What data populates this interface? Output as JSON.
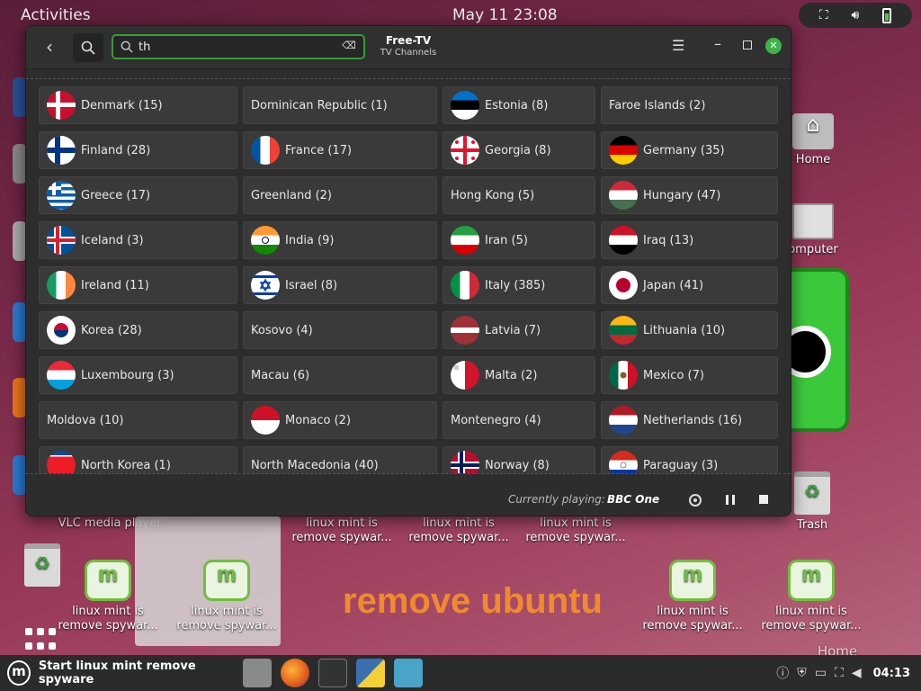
{
  "topbar": {
    "activities": "Activities",
    "clock": "May 11  23:08",
    "system_icons": [
      "network-icon",
      "volume-icon",
      "battery-icon"
    ]
  },
  "desktop": {
    "icons": [
      {
        "label": "Home",
        "type": "folder"
      },
      {
        "label": "omputer",
        "type": "computer"
      },
      {
        "label": "Trash",
        "type": "trash"
      },
      {
        "label": "VLC media player",
        "type": "app"
      },
      {
        "label": "linux mint is remove spywar...",
        "type": "mint"
      },
      {
        "label": "linux mint is remove spywar...",
        "type": "mint"
      },
      {
        "label": "linux mint is remove spywar...",
        "type": "mint"
      },
      {
        "label": "linux mint is remove spywar...",
        "type": "mint"
      },
      {
        "label": "linux mint is remove spywar...",
        "type": "mint"
      },
      {
        "label": "linux mint is remove spywar...",
        "type": "mint"
      },
      {
        "label": "linux mint is remove spywar...",
        "type": "mint"
      }
    ],
    "overlay_text": "remove ubuntu",
    "home_text": "Home"
  },
  "window": {
    "title": "Free-TV",
    "subtitle": "TV Channels",
    "search": {
      "value": "th",
      "placeholder": ""
    },
    "countries": [
      [
        {
          "name": "Denmark (15)",
          "flag": "dk"
        },
        {
          "name": "Dominican Republic (1)",
          "flag": null
        },
        {
          "name": "Estonia (8)",
          "flag": "ee"
        },
        {
          "name": "Faroe Islands (2)",
          "flag": null
        }
      ],
      [
        {
          "name": "Finland (28)",
          "flag": "fi"
        },
        {
          "name": "France (17)",
          "flag": "fr"
        },
        {
          "name": "Georgia (8)",
          "flag": "ge"
        },
        {
          "name": "Germany (35)",
          "flag": "de"
        }
      ],
      [
        {
          "name": "Greece (17)",
          "flag": "gr"
        },
        {
          "name": "Greenland (2)",
          "flag": null
        },
        {
          "name": "Hong Kong (5)",
          "flag": null
        },
        {
          "name": "Hungary (47)",
          "flag": "hu"
        }
      ],
      [
        {
          "name": "Iceland (3)",
          "flag": "is"
        },
        {
          "name": "India (9)",
          "flag": "in"
        },
        {
          "name": "Iran (5)",
          "flag": "ir"
        },
        {
          "name": "Iraq (13)",
          "flag": "iq"
        }
      ],
      [
        {
          "name": "Ireland (11)",
          "flag": "ie"
        },
        {
          "name": "Israel (8)",
          "flag": "il"
        },
        {
          "name": "Italy (385)",
          "flag": "it"
        },
        {
          "name": "Japan (41)",
          "flag": "jp"
        }
      ],
      [
        {
          "name": "Korea (28)",
          "flag": "kr"
        },
        {
          "name": "Kosovo (4)",
          "flag": null
        },
        {
          "name": "Latvia (7)",
          "flag": "lv"
        },
        {
          "name": "Lithuania (10)",
          "flag": "lt"
        }
      ],
      [
        {
          "name": "Luxembourg (3)",
          "flag": "lu"
        },
        {
          "name": "Macau (6)",
          "flag": null
        },
        {
          "name": "Malta (2)",
          "flag": "mt"
        },
        {
          "name": "Mexico (7)",
          "flag": "mx"
        }
      ],
      [
        {
          "name": "Moldova (10)",
          "flag": null
        },
        {
          "name": "Monaco (2)",
          "flag": "mc"
        },
        {
          "name": "Montenegro (4)",
          "flag": null
        },
        {
          "name": "Netherlands (16)",
          "flag": "nl"
        }
      ],
      [
        {
          "name": "North Korea (1)",
          "flag": "kp"
        },
        {
          "name": "North Macedonia (40)",
          "flag": null
        },
        {
          "name": "Norway (8)",
          "flag": "no"
        },
        {
          "name": "Paraguay (3)",
          "flag": "py"
        }
      ]
    ],
    "footer": {
      "currently_playing_label": "Currently playing:",
      "currently_playing_value": "BBC One"
    }
  },
  "taskbar": {
    "start_label": "Start linux mint remove spyware",
    "apps": [
      "files-icon",
      "firefox-icon",
      "terminal-icon",
      "python-icon",
      "freetv-icon"
    ],
    "time": "04:13"
  },
  "colors": {
    "accent": "#3bb54a",
    "window_bg": "#2d2d2d",
    "card_bg": "#3a3a3a",
    "remove_ubuntu": "#f08a2e"
  }
}
